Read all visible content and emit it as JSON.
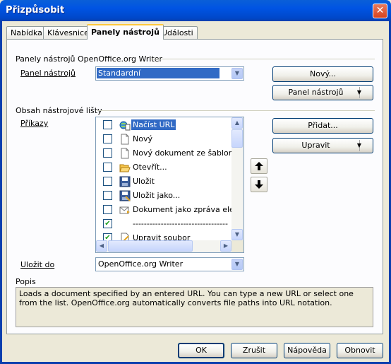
{
  "window": {
    "title": "Přizpůsobit",
    "close_glyph": "✕"
  },
  "tabs": [
    {
      "label": "Nabídka",
      "active": false
    },
    {
      "label": "Klávesnice",
      "active": false
    },
    {
      "label": "Panely nástrojů",
      "active": true
    },
    {
      "label": "Události",
      "active": false
    }
  ],
  "toolbars_group": {
    "title": "Panely nástrojů OpenOffice.org Writer",
    "toolbar_label": "Panel nástrojů",
    "toolbar_value": "Standardní",
    "new_button": "Nový...",
    "toolbar_menu_button": "Panel nástrojů"
  },
  "content_group": {
    "title": "Obsah nástrojové lišty",
    "commands_label": "Příkazy",
    "commands": [
      {
        "label": "Načíst URL",
        "checked": false,
        "selected": true,
        "icon": "load-url-icon"
      },
      {
        "label": "Nový",
        "checked": false,
        "selected": false,
        "icon": "new-document-icon"
      },
      {
        "label": "Nový dokument ze šablony",
        "checked": false,
        "selected": false,
        "icon": "new-from-template-icon"
      },
      {
        "label": "Otevřít...",
        "checked": false,
        "selected": false,
        "icon": "open-folder-icon"
      },
      {
        "label": "Uložit",
        "checked": false,
        "selected": false,
        "icon": "save-icon"
      },
      {
        "label": "Uložit jako...",
        "checked": false,
        "selected": false,
        "icon": "save-as-icon"
      },
      {
        "label": "Dokument jako zpráva elektro",
        "checked": false,
        "selected": false,
        "icon": "email-document-icon"
      },
      {
        "label": "----------------------------------",
        "checked": true,
        "selected": false,
        "icon": ""
      },
      {
        "label": "Upravit soubor",
        "checked": true,
        "selected": false,
        "icon": "edit-file-icon"
      }
    ],
    "add_button": "Přidat...",
    "modify_button": "Upravit",
    "move_up_glyph": "🡅",
    "move_down_glyph": "🡇"
  },
  "save_in": {
    "label": "Uložit do",
    "value": "OpenOffice.org Writer"
  },
  "description": {
    "label": "Popis",
    "text": "Loads a document specified by an entered URL. You can type a new URL or select one from the list. OpenOffice.org automatically converts file paths into URL notation."
  },
  "footer": {
    "ok": "OK",
    "cancel": "Zrušit",
    "help": "Nápověda",
    "reset": "Obnovit"
  },
  "colors": {
    "titlebar": "#0054e3",
    "selection": "#316ac5",
    "dialog_bg": "#ece9d8"
  }
}
